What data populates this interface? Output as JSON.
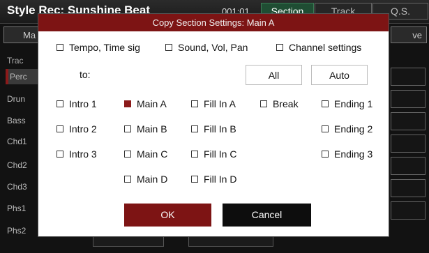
{
  "app": {
    "title": "Style Rec: Sunshine Beat",
    "time": "001:01",
    "tabs": [
      "Section",
      "Track",
      "Q.S."
    ]
  },
  "background": {
    "left_button": "Ma",
    "right_button": "ve",
    "track_header": "Trac",
    "tracks": [
      "Perc",
      "Drun",
      "Bass",
      "Chd1",
      "Chd2",
      "Chd3",
      "Phs1",
      "Phs2"
    ]
  },
  "dialog": {
    "title": "Copy Section Settings: Main A",
    "settings": [
      {
        "label": "Tempo, Time sig",
        "checked": false
      },
      {
        "label": "Sound, Vol, Pan",
        "checked": false
      },
      {
        "label": "Channel settings",
        "checked": false
      }
    ],
    "to_label": "to:",
    "all_label": "All",
    "auto_label": "Auto",
    "sections": {
      "intro1": {
        "label": "Intro 1",
        "checked": false
      },
      "intro2": {
        "label": "Intro 2",
        "checked": false
      },
      "intro3": {
        "label": "Intro 3",
        "checked": false
      },
      "mainA": {
        "label": "Main A",
        "checked": true
      },
      "mainB": {
        "label": "Main B",
        "checked": false
      },
      "mainC": {
        "label": "Main C",
        "checked": false
      },
      "mainD": {
        "label": "Main D",
        "checked": false
      },
      "fillA": {
        "label": "Fill In A",
        "checked": false
      },
      "fillB": {
        "label": "Fill In B",
        "checked": false
      },
      "fillC": {
        "label": "Fill In C",
        "checked": false
      },
      "fillD": {
        "label": "Fill In D",
        "checked": false
      },
      "break": {
        "label": "Break",
        "checked": false
      },
      "ending1": {
        "label": "Ending 1",
        "checked": false
      },
      "ending2": {
        "label": "Ending 2",
        "checked": false
      },
      "ending3": {
        "label": "Ending 3",
        "checked": false
      }
    },
    "ok_label": "OK",
    "cancel_label": "Cancel"
  },
  "colors": {
    "accent": "#7d1414",
    "checked": "#8b1a1a",
    "active_tab": "#1f4d33"
  }
}
